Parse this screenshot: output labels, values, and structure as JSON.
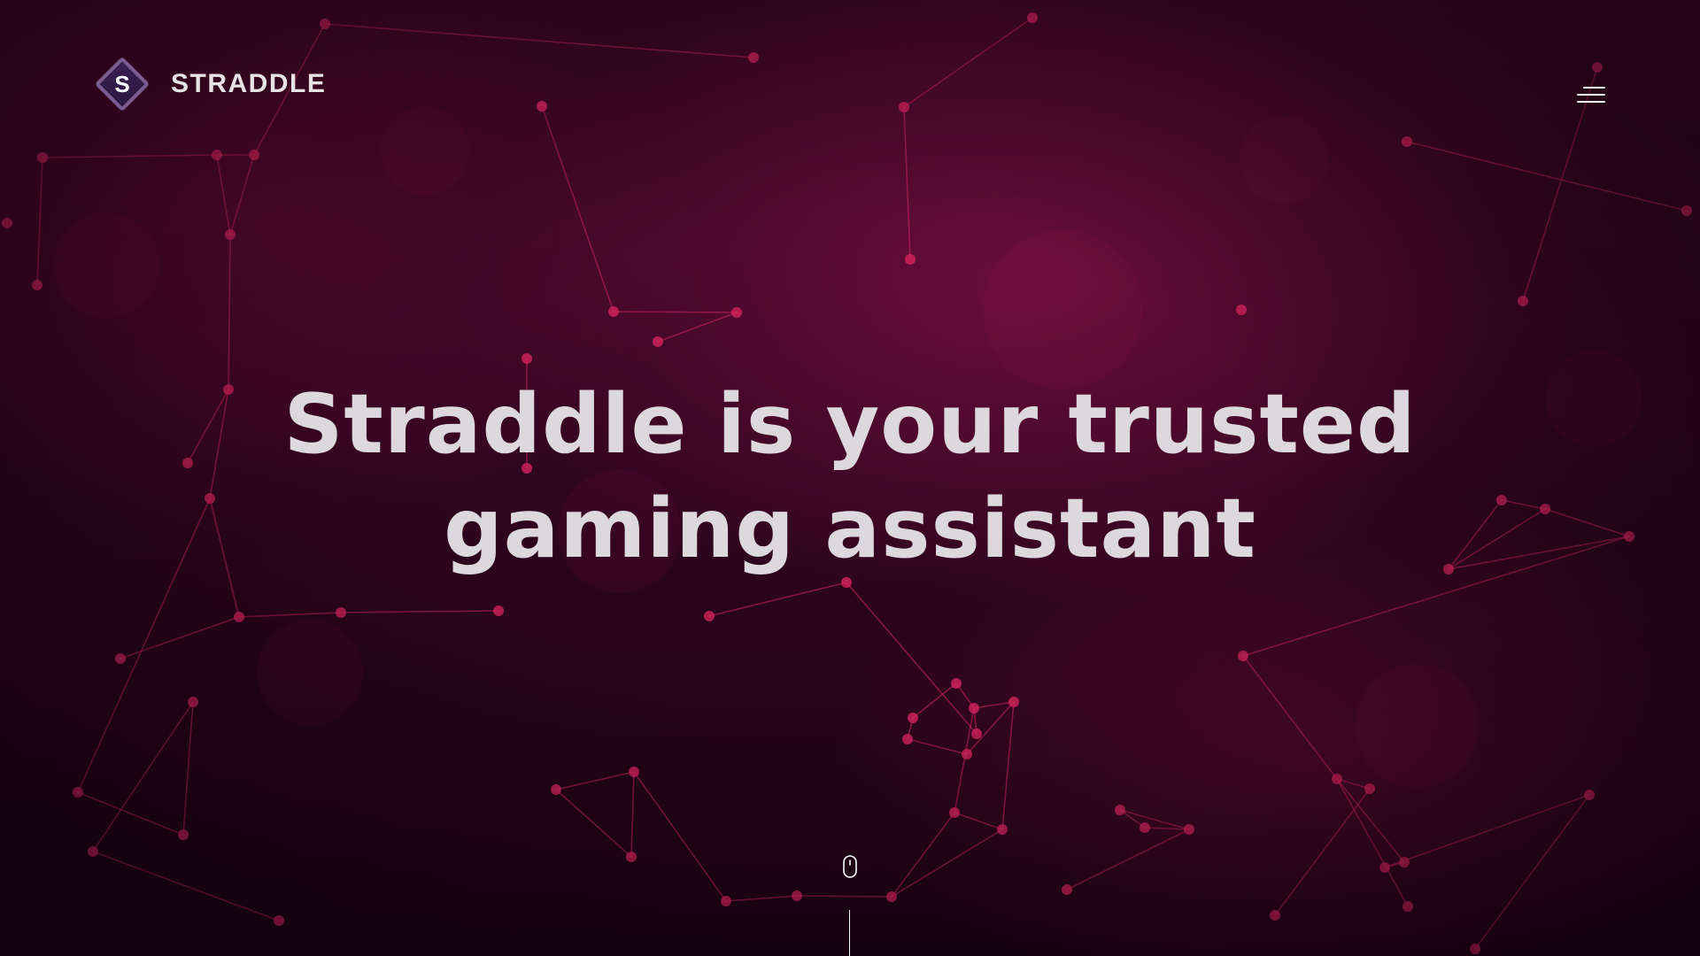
{
  "header": {
    "logo": {
      "mark_letter": "S",
      "brand_name": "STRADDLE"
    },
    "menu_icon": "hamburger-menu-icon"
  },
  "hero": {
    "headline_line1": "Straddle is your trusted",
    "headline_line2": "gaming assistant"
  },
  "scroll_indicator": {
    "icon": "mouse-icon"
  },
  "colors": {
    "background_dark": "#2a0418",
    "network_accent": "#d4245e",
    "logo_diamond_border": "#7a5c92",
    "logo_diamond_fill": "#3b1f54",
    "headline_text": "#dcd8dd",
    "white": "#ffffff"
  }
}
